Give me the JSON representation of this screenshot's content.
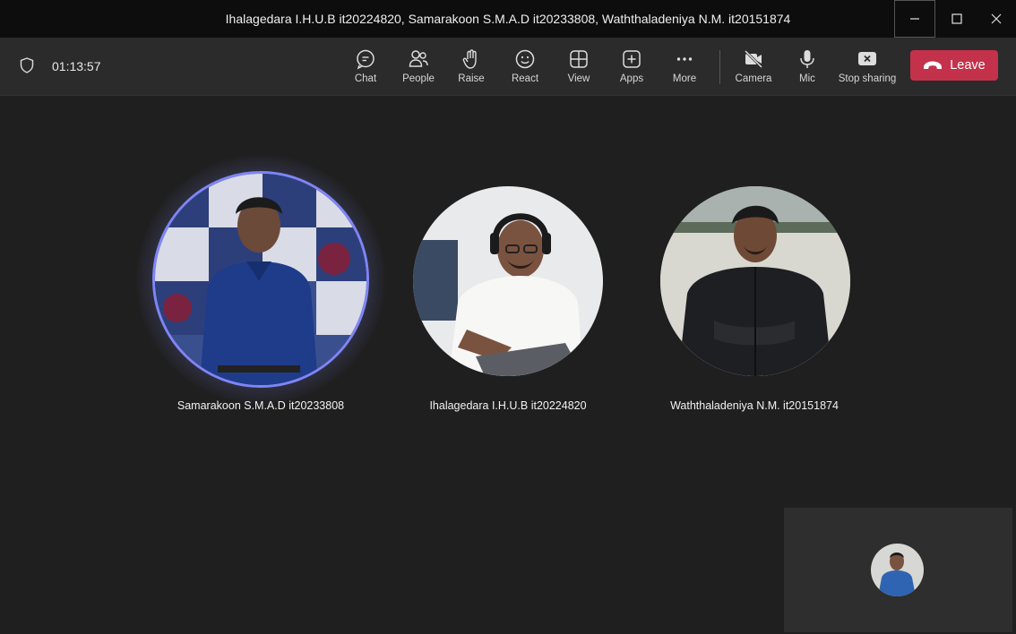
{
  "window": {
    "title": "Ihalagedara I.H.U.B it20224820, Samarakoon S.M.A.D it20233808, Waththaladeniya N.M. it20151874",
    "controls": [
      "minimize-icon",
      "maximize-icon",
      "close-icon"
    ]
  },
  "toolbar": {
    "timer": "01:13:57",
    "tools": [
      {
        "label": "Chat",
        "icon": "chat-icon"
      },
      {
        "label": "People",
        "icon": "people-icon"
      },
      {
        "label": "Raise",
        "icon": "raise-hand-icon"
      },
      {
        "label": "React",
        "icon": "react-icon"
      },
      {
        "label": "View",
        "icon": "view-icon"
      },
      {
        "label": "Apps",
        "icon": "apps-icon"
      },
      {
        "label": "More",
        "icon": "more-icon"
      },
      {
        "label": "Camera",
        "icon": "camera-off-icon"
      },
      {
        "label": "Mic",
        "icon": "mic-icon"
      },
      {
        "label": "Stop sharing",
        "icon": "stop-sharing-icon"
      }
    ],
    "leave_label": "Leave"
  },
  "participants": [
    {
      "name": "Samarakoon S.M.A.D it20233808",
      "speaking": true
    },
    {
      "name": "Ihalagedara I.H.U.B it20224820",
      "speaking": false
    },
    {
      "name": "Waththaladeniya N.M. it20151874",
      "speaking": false
    }
  ],
  "colors": {
    "leave": "#c4314b",
    "speaking_ring": "#7f85f5",
    "stage": "#1f1f1f"
  }
}
